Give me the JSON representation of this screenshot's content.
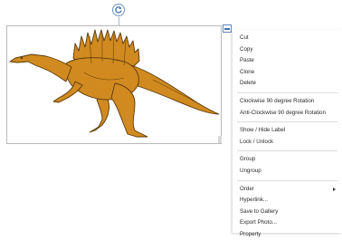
{
  "colors": {
    "menu_text": "#2b2b2b",
    "selection_accent": "#5c85c2",
    "dinosaur_fill": "#d08a20"
  },
  "selection": {
    "rotate_handle_icon": "rotate-icon",
    "options_handle_icon": "minus-icon",
    "image_subject": "spinosaurus-clipart"
  },
  "context_menu": {
    "groups": [
      {
        "items": [
          {
            "label": "Cut"
          },
          {
            "label": "Copy"
          },
          {
            "label": "Paste"
          },
          {
            "label": "Clone"
          },
          {
            "label": "Delete"
          }
        ]
      },
      {
        "items": [
          {
            "label": "Clockwise 90 degree Rotation"
          },
          {
            "label": "Anti-Clockwise 90 degree Rotation"
          }
        ]
      },
      {
        "items": [
          {
            "label": "Show / Hide Label"
          },
          {
            "label": "Lock / Unlock"
          }
        ]
      },
      {
        "items": [
          {
            "label": "Group"
          },
          {
            "label": "Ungroup"
          }
        ]
      },
      {
        "items": [
          {
            "label": "Order",
            "submenu_icon": "chevron-right-icon"
          },
          {
            "label": "Hyperlink..."
          },
          {
            "label": "Save to Gallery"
          },
          {
            "label": "Export Photo..."
          },
          {
            "label": "Property"
          }
        ]
      }
    ]
  }
}
